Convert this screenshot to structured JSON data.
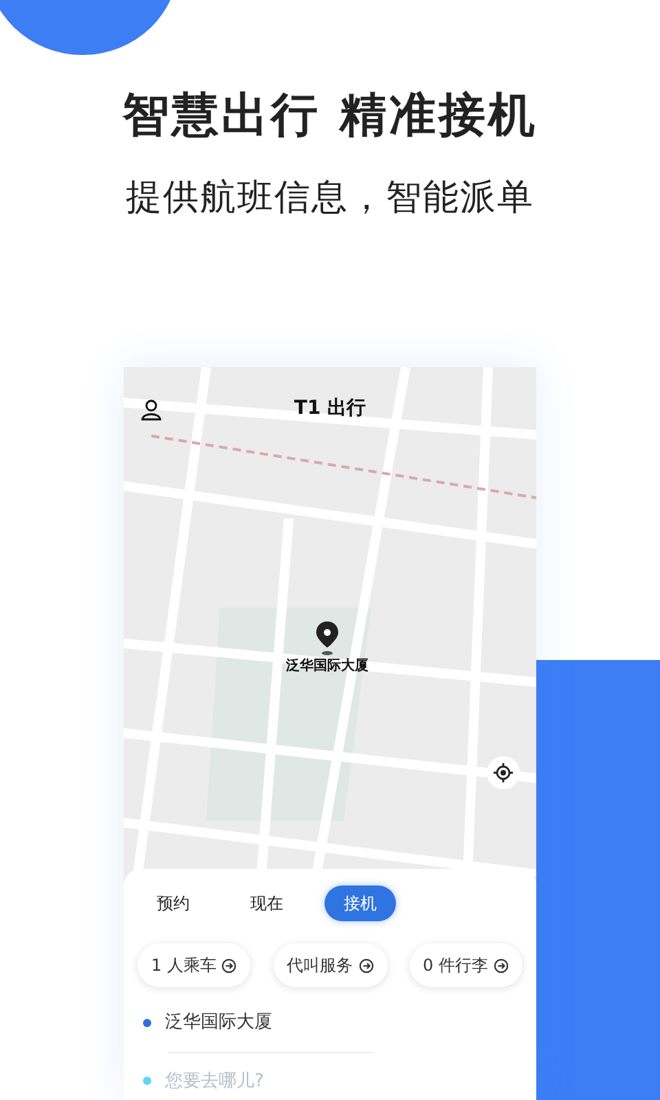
{
  "headline": "智慧出行 精准接机",
  "subheadline": "提供航班信息，智能派单",
  "app": {
    "title": "T1 出行",
    "pin_label": "泛华国际大厦",
    "modes": [
      {
        "label": "预约",
        "selected": false
      },
      {
        "label": "现在",
        "selected": false
      },
      {
        "label": "接机",
        "selected": true
      }
    ],
    "options": [
      "1 人乘车",
      "代叫服务",
      "0 件行李"
    ],
    "origin": {
      "value": "泛华国际大厦"
    },
    "destination": {
      "placeholder": "您要去哪儿?"
    }
  }
}
